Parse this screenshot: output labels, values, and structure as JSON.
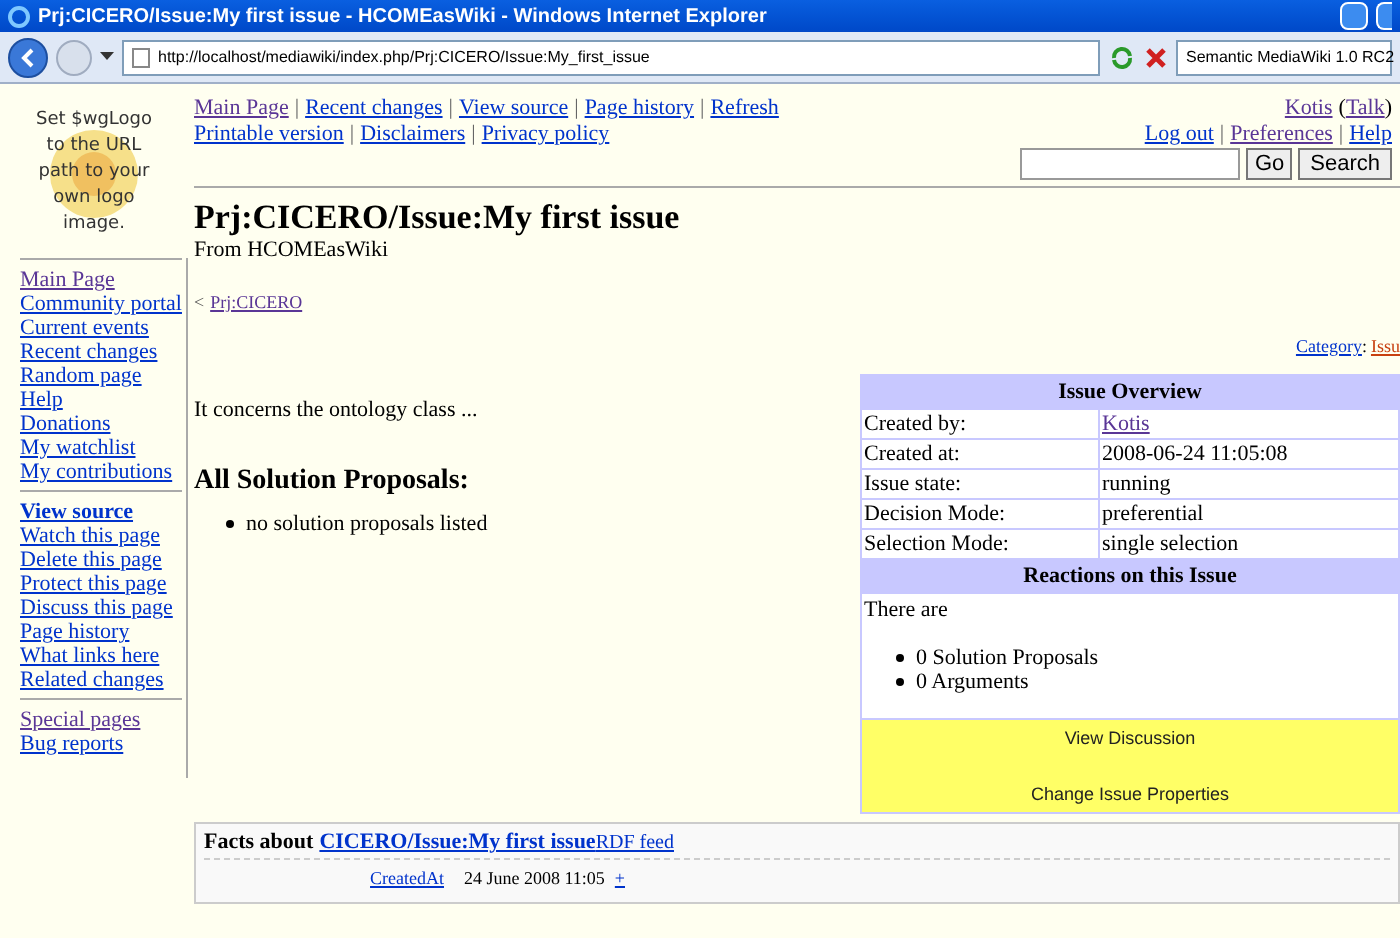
{
  "window": {
    "title": "Prj:CICERO/Issue:My first issue - HCOMEasWiki - Windows Internet Explorer"
  },
  "address_bar": {
    "url": "http://localhost/mediawiki/index.php/Prj:CICERO/Issue:My_first_issue"
  },
  "search_provider": {
    "value": "Semantic MediaWiki 1.0 RC2"
  },
  "logo": {
    "text": "Set $wgLogo to the URL path to your own logo image."
  },
  "sidebar": {
    "groups": [
      [
        {
          "label": "Main Page",
          "visited": true,
          "bold": false
        },
        {
          "label": "Community portal",
          "visited": false,
          "bold": false
        },
        {
          "label": "Current events",
          "visited": false,
          "bold": false
        },
        {
          "label": "Recent changes",
          "visited": false,
          "bold": false
        },
        {
          "label": "Random page",
          "visited": false,
          "bold": false
        },
        {
          "label": "Help",
          "visited": false,
          "bold": false
        },
        {
          "label": "Donations",
          "visited": false,
          "bold": false
        },
        {
          "label": "My watchlist",
          "visited": false,
          "bold": false
        },
        {
          "label": "My contributions",
          "visited": false,
          "bold": false
        }
      ],
      [
        {
          "label": "View source",
          "visited": false,
          "bold": true
        },
        {
          "label": "Watch this page",
          "visited": false,
          "bold": false
        },
        {
          "label": "Delete this page",
          "visited": false,
          "bold": false
        },
        {
          "label": "Protect this page",
          "visited": false,
          "bold": false
        },
        {
          "label": "Discuss this page",
          "visited": false,
          "bold": false
        },
        {
          "label": "Page history",
          "visited": false,
          "bold": false
        },
        {
          "label": "What links here",
          "visited": false,
          "bold": false
        },
        {
          "label": "Related changes",
          "visited": false,
          "bold": false
        }
      ],
      [
        {
          "label": "Special pages",
          "visited": true,
          "bold": false
        },
        {
          "label": "Bug reports",
          "visited": false,
          "bold": false
        }
      ]
    ]
  },
  "top_links": [
    [
      {
        "label": "Main Page",
        "visited": true
      },
      {
        "prefix": "|",
        "label": "Recent changes",
        "visited": false
      },
      {
        "prefix": "|",
        "label": "View source",
        "visited": false
      },
      {
        "prefix": "|",
        "label": "Page history",
        "visited": false
      },
      {
        "prefix": "|",
        "label": "Refresh",
        "visited": false
      }
    ],
    [
      {
        "label": "Printable version",
        "visited": false
      },
      {
        "prefix": "|",
        "label": "Disclaimers",
        "visited": false
      },
      {
        "prefix": "|",
        "label": "Privacy policy",
        "visited": false
      }
    ]
  ],
  "user_links": {
    "user": {
      "label": "Kotis",
      "visited": true
    },
    "talk": {
      "prefix": "(",
      "label": "Talk",
      "visited": true,
      "suffix": ")"
    },
    "links": [
      {
        "label": "Log out",
        "visited": false
      },
      {
        "prefix": "|",
        "label": "Preferences",
        "visited": true
      },
      {
        "prefix": "|",
        "label": "Help",
        "visited": false
      }
    ]
  },
  "search": {
    "go": "Go",
    "search": "Search"
  },
  "page": {
    "title": "Prj:CICERO/Issue:My first issue",
    "subtitle": "From HCOMEasWiki",
    "breadcrumb_prefix": "<",
    "breadcrumb": {
      "label": "Prj:CICERO",
      "visited": true
    },
    "category_label": "Category",
    "category_separator": ":",
    "category_value": "Issu",
    "intro": "It concerns the ontology class ...",
    "section_title": "All Solution Proposals:",
    "section_items": [
      "no solution proposals listed"
    ]
  },
  "infobox": {
    "title": "Issue Overview",
    "rows": [
      {
        "label": "Created by:",
        "value": "Kotis",
        "kind": "link"
      },
      {
        "label": "Created at:",
        "value": "2008-06-24 11:05:08",
        "kind": "text"
      },
      {
        "label": "Issue state:",
        "value": "running",
        "kind": "text"
      },
      {
        "label": "Decision Mode:",
        "value": "preferential",
        "kind": "text"
      },
      {
        "label": "Selection Mode:",
        "value": "single selection",
        "kind": "text"
      }
    ],
    "reactions_title": "Reactions on this Issue",
    "reactions_intro": "There are",
    "reactions": [
      "0 Solution Proposals",
      "0 Arguments"
    ],
    "actions": [
      "View Discussion",
      "Change Issue Properties"
    ]
  },
  "facts": {
    "prefix": "Facts about",
    "subject": "CICERO/Issue:My first issue",
    "feed": "RDF feed",
    "rows": [
      {
        "property": "CreatedAt",
        "value": "24 June 2008 11:05",
        "plus": "+"
      }
    ]
  }
}
